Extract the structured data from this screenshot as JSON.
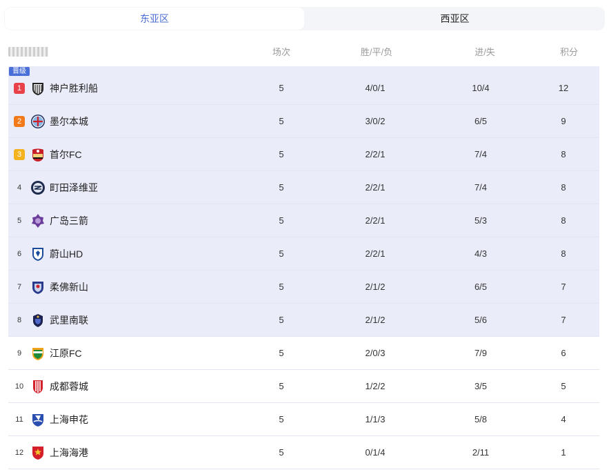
{
  "tabs": [
    {
      "label": "东亚区",
      "active": true
    },
    {
      "label": "西亚区",
      "active": false
    }
  ],
  "columns": {
    "played": "场次",
    "wdl": "胜/平/负",
    "goals": "进/失",
    "points": "积分"
  },
  "promotion_label": "晋级",
  "colors": {
    "accent": "#4a6cd4",
    "promo_bg": "#eaedf9",
    "rank1": "#e8414a",
    "rank2": "#f27a1a",
    "rank3": "#f5b21f"
  },
  "rows": [
    {
      "rank": "1",
      "team": "神户胜利船",
      "played": "5",
      "wdl": "4/0/1",
      "goals": "10/4",
      "points": "12",
      "logo": "vissel-kobe-crest-icon"
    },
    {
      "rank": "2",
      "team": "墨尔本城",
      "played": "5",
      "wdl": "3/0/2",
      "goals": "6/5",
      "points": "9",
      "logo": "melbourne-city-crest-icon"
    },
    {
      "rank": "3",
      "team": "首尔FC",
      "played": "5",
      "wdl": "2/2/1",
      "goals": "7/4",
      "points": "8",
      "logo": "fc-seoul-crest-icon"
    },
    {
      "rank": "4",
      "team": "町田泽维亚",
      "played": "5",
      "wdl": "2/2/1",
      "goals": "7/4",
      "points": "8",
      "logo": "machida-zelvia-crest-icon"
    },
    {
      "rank": "5",
      "team": "广岛三箭",
      "played": "5",
      "wdl": "2/2/1",
      "goals": "5/3",
      "points": "8",
      "logo": "sanfrecce-hiroshima-crest-icon"
    },
    {
      "rank": "6",
      "team": "蔚山HD",
      "played": "5",
      "wdl": "2/2/1",
      "goals": "4/3",
      "points": "8",
      "logo": "ulsan-hd-crest-icon"
    },
    {
      "rank": "7",
      "team": "柔佛新山",
      "played": "5",
      "wdl": "2/1/2",
      "goals": "6/5",
      "points": "7",
      "logo": "johor-darul-tazim-crest-icon"
    },
    {
      "rank": "8",
      "team": "武里南联",
      "played": "5",
      "wdl": "2/1/2",
      "goals": "5/6",
      "points": "7",
      "logo": "buriram-united-crest-icon"
    },
    {
      "rank": "9",
      "team": "江原FC",
      "played": "5",
      "wdl": "2/0/3",
      "goals": "7/9",
      "points": "6",
      "logo": "gangwon-fc-crest-icon"
    },
    {
      "rank": "10",
      "team": "成都蓉城",
      "played": "5",
      "wdl": "1/2/2",
      "goals": "3/5",
      "points": "5",
      "logo": "chengdu-rongcheng-crest-icon"
    },
    {
      "rank": "11",
      "team": "上海申花",
      "played": "5",
      "wdl": "1/1/3",
      "goals": "5/8",
      "points": "4",
      "logo": "shanghai-shenhua-crest-icon"
    },
    {
      "rank": "12",
      "team": "上海海港",
      "played": "5",
      "wdl": "0/1/4",
      "goals": "2/11",
      "points": "1",
      "logo": "shanghai-port-crest-icon"
    }
  ]
}
